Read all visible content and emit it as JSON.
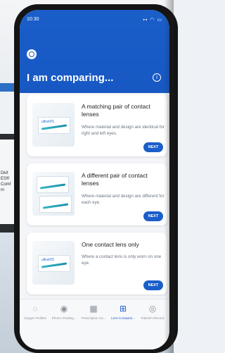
{
  "background": {
    "laptop_lines": [
      "Dk/t",
      "ES®",
      "Comf",
      "m"
    ]
  },
  "status_bar": {
    "time": "10:30",
    "signal": "▪▪ ◠ ▭"
  },
  "header": {
    "title": "I am comparing...",
    "info_icon": "info-icon",
    "logo_icon": "logo-icon"
  },
  "cards": [
    {
      "title": "A matching pair of contact lenses",
      "description": "Where material and design are identical for right and left eyes.",
      "button": "NEXT",
      "box_labels": [
        "ultraVIS"
      ]
    },
    {
      "title": "A different pair of contact lenses",
      "description": "Where material and design are different for each eye.",
      "button": "NEXT",
      "box_labels": [
        "",
        ""
      ]
    },
    {
      "title": "One contact lens only",
      "description": "Where a contact lens is only worn on one eye.",
      "button": "NEXT",
      "box_labels": [
        "ultraVIS"
      ]
    }
  ],
  "nav": [
    {
      "label": "Oxygen Profiles",
      "icon": "oxygen-icon",
      "glyph": "◌"
    },
    {
      "label": "Efron's Grading...",
      "icon": "eye-icon",
      "glyph": "◉"
    },
    {
      "label": "Prescription Ca...",
      "icon": "calculator-icon",
      "glyph": "▦"
    },
    {
      "label": "Lens Comparis...",
      "icon": "compare-icon",
      "glyph": "⊞",
      "active": true
    },
    {
      "label": "Patient's Record",
      "icon": "patient-icon",
      "glyph": "◎"
    }
  ],
  "colors": {
    "primary": "#1a5ec9",
    "card_bg": "#ffffff",
    "screen_bg": "#f3f5f8"
  }
}
